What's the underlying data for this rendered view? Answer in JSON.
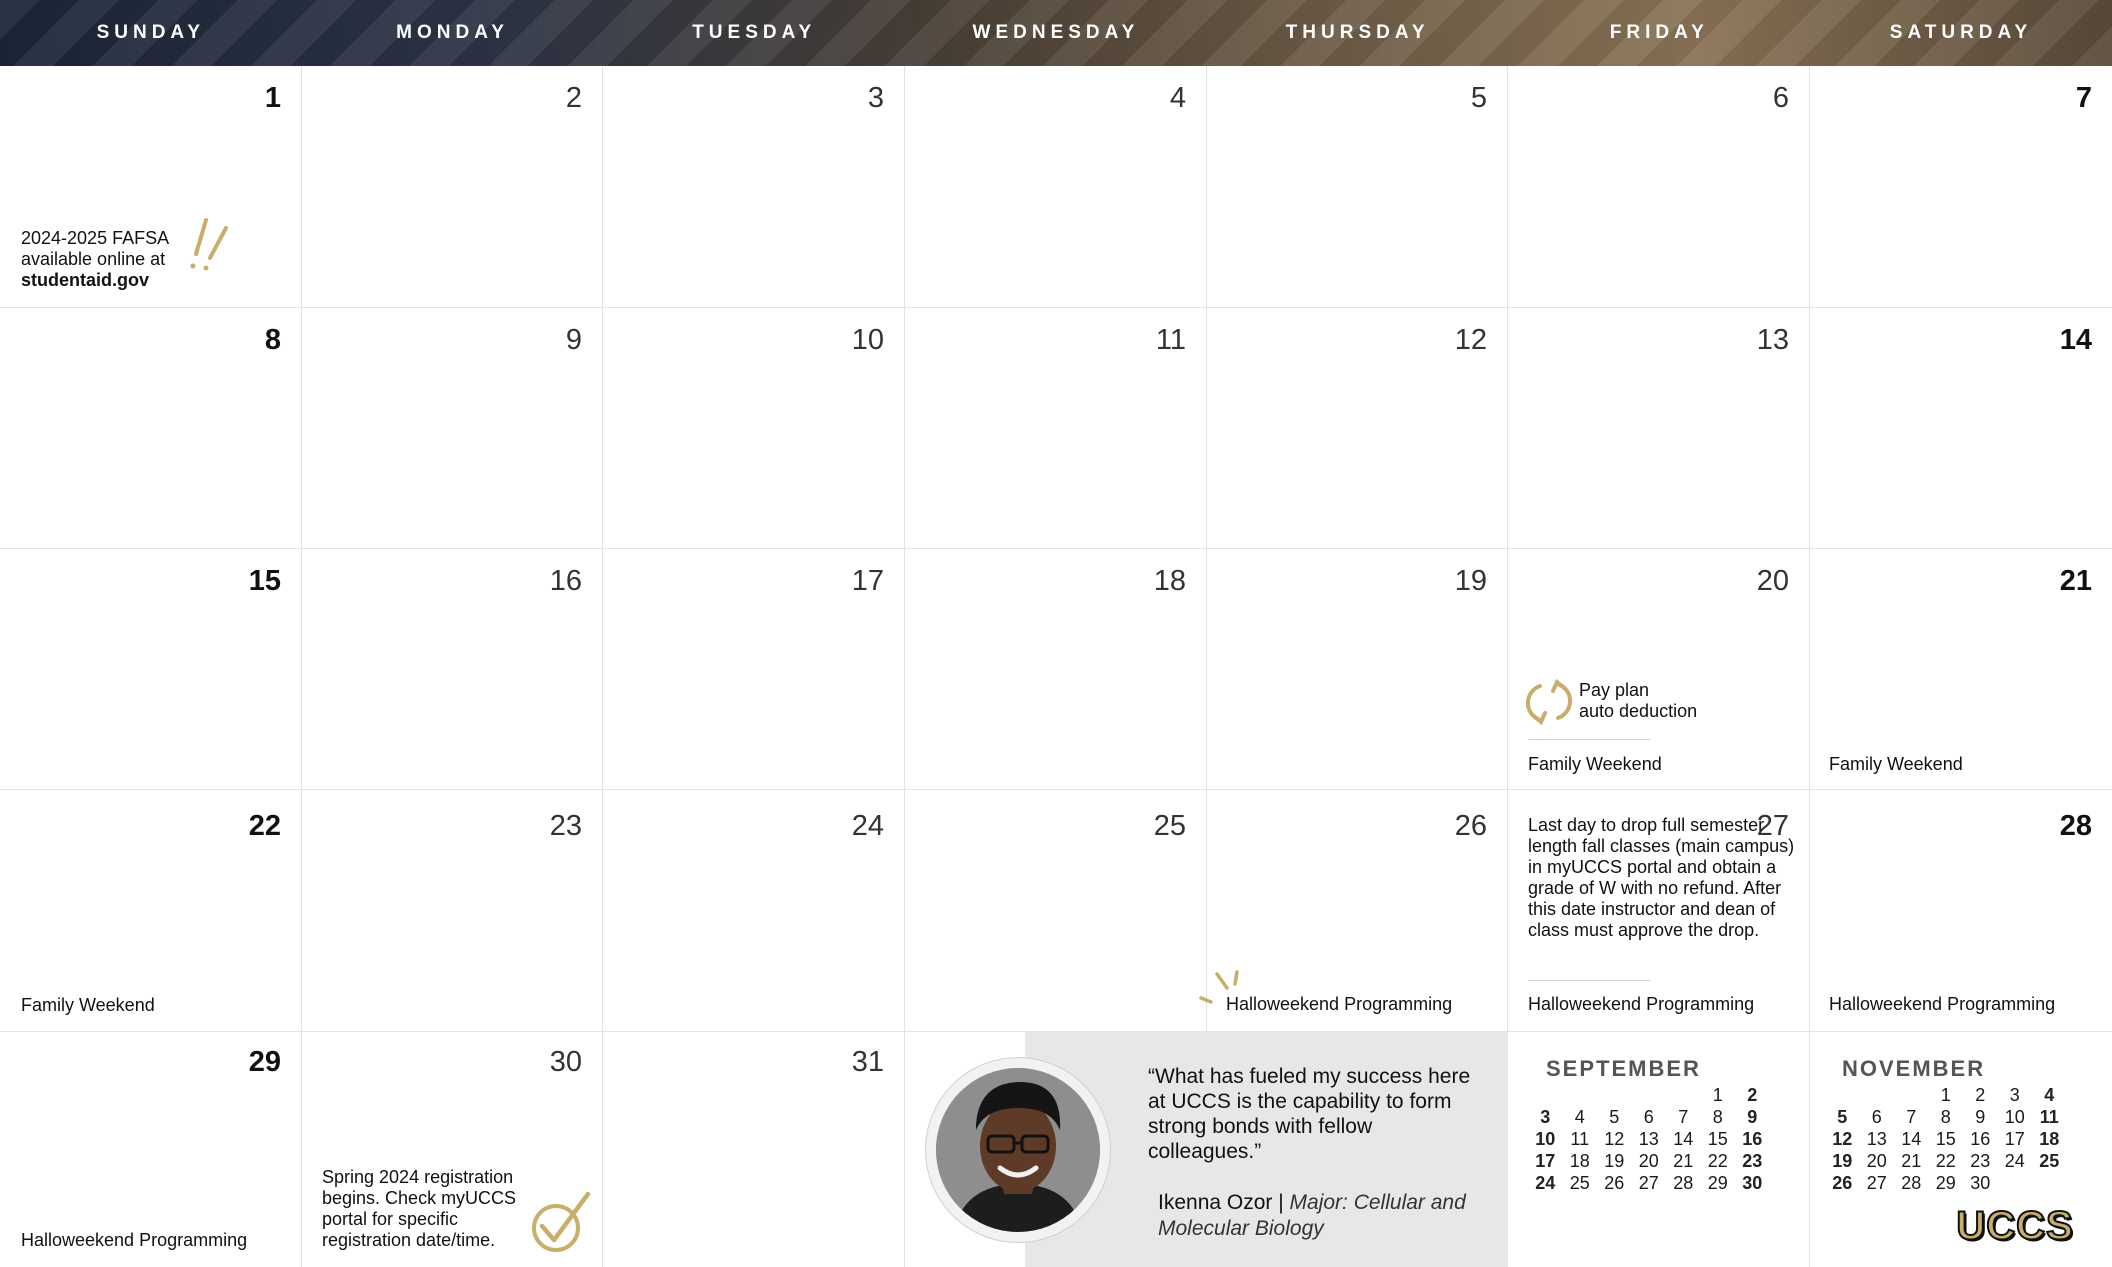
{
  "days": [
    "SUNDAY",
    "MONDAY",
    "TUESDAY",
    "WEDNESDAY",
    "THURSDAY",
    "FRIDAY",
    "SATURDAY"
  ],
  "cells": {
    "d1": "1",
    "d2": "2",
    "d3": "3",
    "d4": "4",
    "d5": "5",
    "d6": "6",
    "d7": "7",
    "d8": "8",
    "d9": "9",
    "d10": "10",
    "d11": "11",
    "d12": "12",
    "d13": "13",
    "d14": "14",
    "d15": "15",
    "d16": "16",
    "d17": "17",
    "d18": "18",
    "d19": "19",
    "d20": "20",
    "d21": "21",
    "d22": "22",
    "d23": "23",
    "d24": "24",
    "d25": "25",
    "d26": "26",
    "d27": "27",
    "d28": "28",
    "d29": "29",
    "d30": "30",
    "d31": "31"
  },
  "events": {
    "fafsa_line1": "2024-2025 FAFSA",
    "fafsa_line2": "available online at",
    "fafsa_link": "studentaid.gov",
    "payplan_line1": "Pay plan",
    "payplan_line2": "auto deduction",
    "family_weekend": "Family Weekend",
    "drop_deadline": "Last day to drop full semester length fall classes (main campus) in myUCCS portal and obtain a grade of W with no refund. After this date instructor and dean of class must approve the drop.",
    "halloweekend": "Halloweekend Programming",
    "registration": "Spring 2024 registration begins. Check myUCCS portal for specific registration date/time."
  },
  "quote": {
    "text": "“What has fueled my success here at UCCS is the capability to form strong bonds with fellow colleagues.”",
    "name": "Ikenna Ozor",
    "separator": " | ",
    "major": "Major: Cellular and Molecular Biology"
  },
  "mini_calendars": {
    "september": {
      "title": "SEPTEMBER",
      "weeks": [
        [
          "",
          "",
          "",
          "",
          "",
          "1",
          "2"
        ],
        [
          "3",
          "4",
          "5",
          "6",
          "7",
          "8",
          "9"
        ],
        [
          "10",
          "11",
          "12",
          "13",
          "14",
          "15",
          "16"
        ],
        [
          "17",
          "18",
          "19",
          "20",
          "21",
          "22",
          "23"
        ],
        [
          "24",
          "25",
          "26",
          "27",
          "28",
          "29",
          "30"
        ]
      ]
    },
    "november": {
      "title": "NOVEMBER",
      "weeks": [
        [
          "",
          "",
          "",
          "1",
          "2",
          "3",
          "4"
        ],
        [
          "5",
          "6",
          "7",
          "8",
          "9",
          "10",
          "11"
        ],
        [
          "12",
          "13",
          "14",
          "15",
          "16",
          "17",
          "18"
        ],
        [
          "19",
          "20",
          "21",
          "22",
          "23",
          "24",
          "25"
        ],
        [
          "26",
          "27",
          "28",
          "29",
          "30",
          "",
          ""
        ]
      ]
    }
  },
  "logo": "UCCS",
  "colors": {
    "accent_gold": "#c9ad6a",
    "header_dark": "#1c2638",
    "quote_bg": "#e6e7e8"
  }
}
